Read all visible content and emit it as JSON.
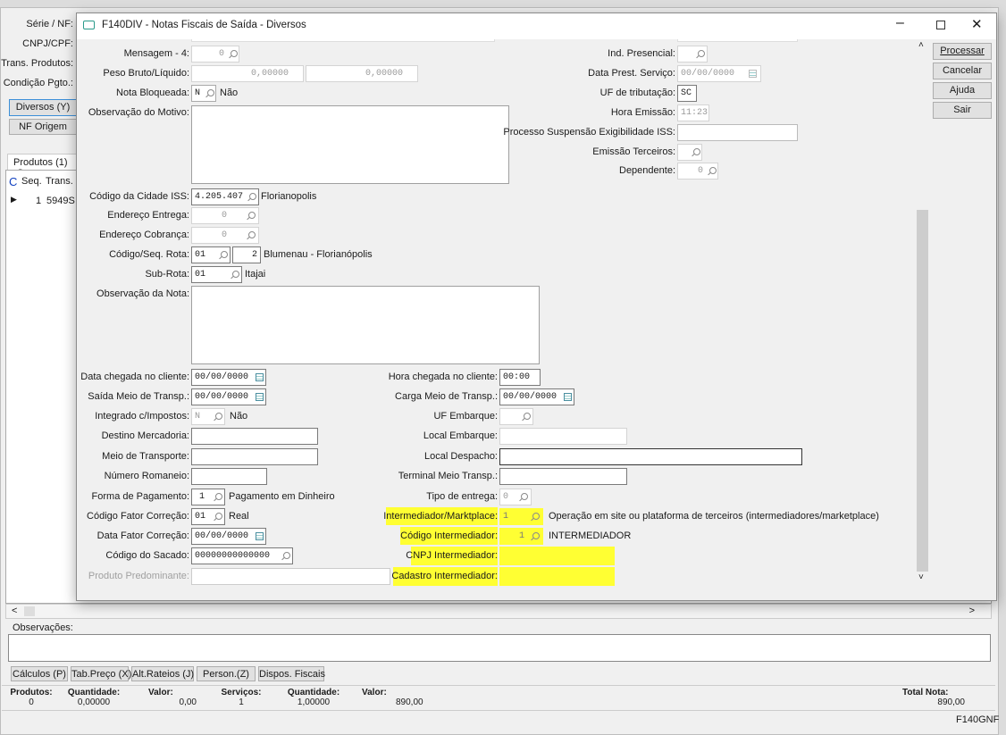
{
  "background": {
    "labels": [
      "Série / NF:",
      "CNPJ/CPF:",
      "Trans. Produtos:",
      "Condição Pgto.:"
    ],
    "buttons": {
      "diversos": "Diversos (Y)",
      "nf_origem": "NF Origem"
    },
    "tab": "Produtos (1)",
    "tab2": "S",
    "grid": {
      "headers": [
        "C",
        "Seq.",
        "Trans. S"
      ],
      "rows": [
        {
          "seq": "1",
          "trans": "5949S"
        }
      ]
    },
    "observacoes_label": "Observações:",
    "bottom_buttons": [
      "Cálculos (P)",
      "Tab.Preço (X)",
      "Alt.Rateios (J)",
      "Person.(Z)",
      "Dispos. Fiscais"
    ],
    "totals": {
      "produtos": {
        "label": "Produtos:",
        "value": "0"
      },
      "quantidade_p": {
        "label": "Quantidade:",
        "value": "0,00000"
      },
      "valor_p": {
        "label": "Valor:",
        "value": "0,00"
      },
      "servicos": {
        "label": "Serviços:",
        "value": "1"
      },
      "quantidade_s": {
        "label": "Quantidade:",
        "value": "1,00000"
      },
      "valor_s": {
        "label": "Valor:",
        "value": "890,00"
      },
      "total_nota": {
        "label": "Total Nota:",
        "value": "890,00"
      }
    },
    "status": "F140GNF"
  },
  "dialog": {
    "title": "F140DIV - Notas Fiscais de Saída - Diversos",
    "buttons": {
      "processar": "Processar",
      "cancelar": "Cancelar",
      "ajuda": "Ajuda",
      "sair": "Sair"
    },
    "left": {
      "mensagem4": {
        "label": "Mensagem - 4:",
        "value": "0"
      },
      "peso": {
        "label": "Peso Bruto/Líquido:",
        "bruto": "0,00000",
        "liquido": "0,00000"
      },
      "nota_bloqueada": {
        "label": "Nota Bloqueada:",
        "value": "N",
        "desc": "Não"
      },
      "obs_motivo": {
        "label": "Observação do Motivo:"
      },
      "cidade_iss": {
        "label": "Código da Cidade ISS:",
        "value": "4.205.407",
        "desc": "Florianopolis"
      },
      "end_entrega": {
        "label": "Endereço Entrega:",
        "value": "0"
      },
      "end_cobranca": {
        "label": "Endereço Cobrança:",
        "value": "0"
      },
      "rota": {
        "label": "Código/Seq. Rota:",
        "value": "01",
        "seq": "2",
        "desc": "Blumenau - Florianópolis"
      },
      "sub_rota": {
        "label": "Sub-Rota:",
        "value": "01",
        "desc": "Itajai"
      },
      "obs_nota": {
        "label": "Observação da Nota:"
      },
      "data_chegada": {
        "label": "Data chegada no cliente:",
        "value": "00/00/0000"
      },
      "saida_meio": {
        "label": "Saída Meio de Transp.:",
        "value": "00/00/0000"
      },
      "integrado": {
        "label": "Integrado c/Impostos:",
        "value": "N",
        "desc": "Não"
      },
      "destino": {
        "label": "Destino Mercadoria:",
        "value": ""
      },
      "meio_transporte": {
        "label": "Meio de Transporte:",
        "value": ""
      },
      "romaneio": {
        "label": "Número Romaneio:",
        "value": ""
      },
      "forma_pagamento": {
        "label": "Forma de Pagamento:",
        "value": "1",
        "desc": "Pagamento em Dinheiro"
      },
      "fator_correcao": {
        "label": "Código Fator Correção:",
        "value": "01",
        "desc": "Real"
      },
      "data_fator": {
        "label": "Data Fator Correção:",
        "value": "00/00/0000"
      },
      "sacado": {
        "label": "Código do Sacado:",
        "value": "00000000000000"
      },
      "produto_predominante": {
        "label": "Produto Predominante:",
        "value": ""
      }
    },
    "top_right": {
      "ind_presencial": {
        "label": "Ind. Presencial:",
        "value": ""
      },
      "data_prest": {
        "label": "Data Prest. Serviço:",
        "value": "00/00/0000"
      },
      "uf_tributacao": {
        "label": "UF de tributação:",
        "value": "SC"
      },
      "hora_emissao": {
        "label": "Hora Emissão:",
        "value": "11:23"
      },
      "processo_iss": {
        "label": "Processo Suspensão Exigibilidade ISS:",
        "value": ""
      },
      "emissao_terceiros": {
        "label": "Emissão Terceiros:",
        "value": ""
      },
      "dependente": {
        "label": "Dependente:",
        "value": "0"
      }
    },
    "right": {
      "hora_chegada": {
        "label": "Hora chegada no cliente:",
        "value": "00:00"
      },
      "carga_meio": {
        "label": "Carga Meio de Transp.:",
        "value": "00/00/0000"
      },
      "uf_embarque": {
        "label": "UF Embarque:",
        "value": ""
      },
      "local_embarque": {
        "label": "Local Embarque:",
        "value": ""
      },
      "local_despacho": {
        "label": "Local Despacho:",
        "value": ""
      },
      "terminal": {
        "label": "Terminal Meio Transp.:",
        "value": ""
      },
      "tipo_entrega": {
        "label": "Tipo de entrega:",
        "value": "0"
      },
      "intermediador": {
        "label": "Intermediador/Marktplace:",
        "value": "1",
        "desc": "Operação em site ou plataforma de terceiros (intermediadores/marketplace)"
      },
      "codigo_intermediador": {
        "label": "Código Intermediador:",
        "value": "1",
        "desc": "INTERMEDIADOR"
      },
      "cnpj_intermediador": {
        "label": "CNPJ Intermediador:",
        "value": ""
      },
      "cadastro_intermediador": {
        "label": "Cadastro Intermediador:",
        "value": ""
      }
    },
    "highlight_color": "#ffff33"
  }
}
